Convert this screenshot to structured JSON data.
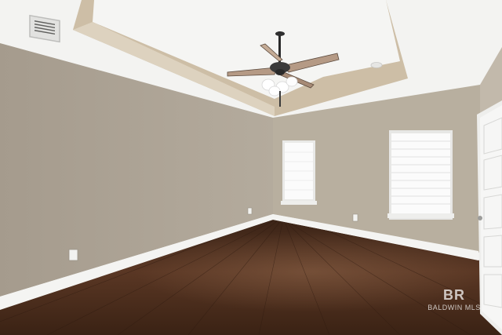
{
  "photo": {
    "subject": "empty-room",
    "colors": {
      "wall_left": "#aea496",
      "wall_back": "#b9b0a2",
      "ceiling": "#f4f4f2",
      "tray": "#ccbda4",
      "baseboard": "#f5f5f3",
      "floor": "#4a2d1d",
      "window": "#f6f6f6",
      "door": "#f1f1f1"
    },
    "icons": [
      "ceiling-fan-icon",
      "hvac-vent-icon",
      "outlet-icon",
      "smoke-detector-icon"
    ]
  },
  "watermark": {
    "logo": "BR",
    "text": "BALDWIN MLS"
  }
}
